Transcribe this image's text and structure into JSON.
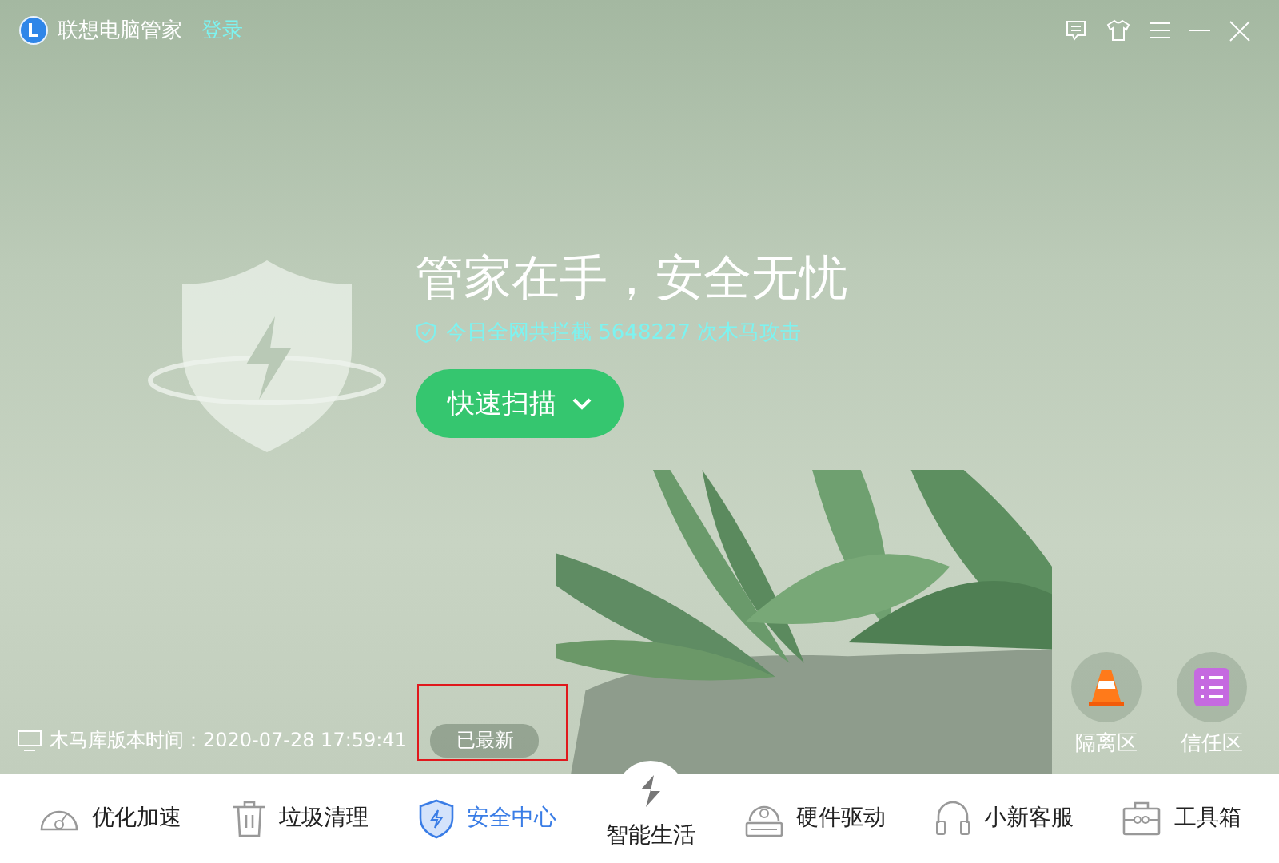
{
  "window": {
    "title": "联想电脑管家",
    "login": "登录"
  },
  "hero": {
    "headline": "管家在手，安全无忧",
    "subtitle": "今日全网共拦截 5648227 次木马攻击",
    "scan_button": "快速扫描"
  },
  "status": {
    "label": "木马库版本时间：2020-07-28 17:59:41",
    "badge": "已最新",
    "highlighted": true
  },
  "quick_actions": [
    {
      "label": "隔离区",
      "kind": "cone"
    },
    {
      "label": "信任区",
      "kind": "list"
    }
  ],
  "nav": [
    {
      "label": "优化加速",
      "kind": "gauge",
      "selected": false
    },
    {
      "label": "垃圾清理",
      "kind": "trash",
      "selected": false
    },
    {
      "label": "安全中心",
      "kind": "shield",
      "selected": true
    },
    {
      "label": "智能生活",
      "kind": "smart",
      "selected": false
    },
    {
      "label": "硬件驱动",
      "kind": "disk",
      "selected": false
    },
    {
      "label": "小新客服",
      "kind": "headset",
      "selected": false
    },
    {
      "label": "工具箱",
      "kind": "toolbox",
      "selected": false
    }
  ]
}
